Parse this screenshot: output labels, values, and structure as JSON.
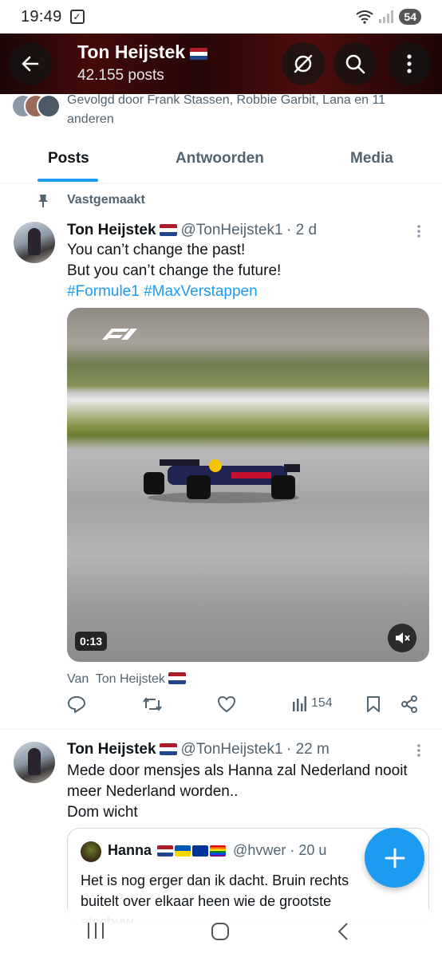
{
  "status_bar": {
    "time": "19:49",
    "battery": "54"
  },
  "header": {
    "title": "Ton Heijstek",
    "posts_count": "42.155 posts"
  },
  "followed_by": {
    "text": "Gevolgd door Frank Stassen, Robbie Garbit, Lana en 11 anderen"
  },
  "tabs": [
    {
      "label": "Posts",
      "active": true
    },
    {
      "label": "Antwoorden",
      "active": false
    },
    {
      "label": "Media",
      "active": false
    }
  ],
  "tweets": [
    {
      "pinned_label": "Vastgemaakt",
      "name": "Ton Heijstek",
      "handle": "@TonHeijstek1",
      "time": "· 2 d",
      "lines": [
        "You can’t change the past!",
        "But you can’t change the future!"
      ],
      "hashtags": "#Formule1 #MaxVerstappen",
      "video": {
        "duration": "0:13",
        "muted": true
      },
      "from_label": "Van",
      "from_name": "Ton Heijstek",
      "views": "154"
    },
    {
      "name": "Ton Heijstek",
      "handle": "@TonHeijstek1",
      "time": "· 22 m",
      "lines": [
        "Mede door mensjes als Hanna zal Nederland nooit meer Nederland worden..",
        "Dom wicht"
      ],
      "quote": {
        "name": "Hanna",
        "handle": "@hvwer",
        "time": "· 20 u",
        "text": "Het is nog erger dan ik dacht. Bruin rechts buitelt over elkaar heen wie de grootste afschuw"
      }
    }
  ],
  "colors": {
    "accent": "#1d9bf0",
    "secondary_text": "#536471",
    "primary_text": "#0f1419",
    "header_bg": "#5a1010"
  }
}
